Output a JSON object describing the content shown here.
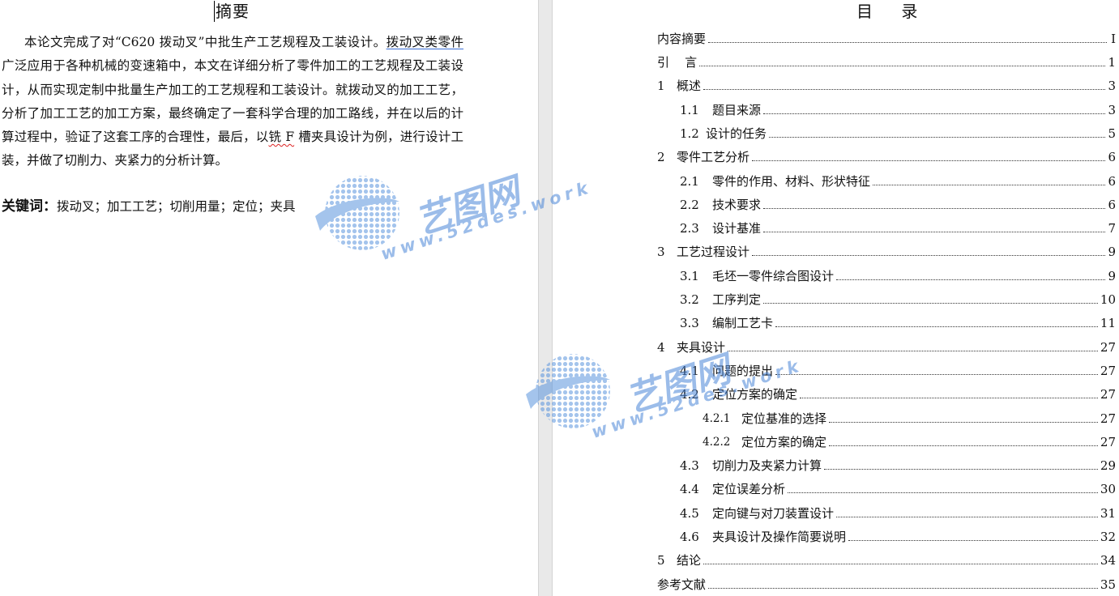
{
  "abstract": {
    "title": "摘要",
    "body_part1": "本论文完成了对“C620 拨动叉”中批生产工艺规程及工装设计。",
    "body_link": "拨动叉类零件",
    "body_part2": "广泛应用于各种机械的变速箱中，本文在详细分析了零件加工的工艺规程及工装设计，从而实现定制中批量生产加工的工艺规程和工装设计。就拨动叉的加工工艺，分析了加工工艺的加工方案，最终确定了一套科学合理的加工路线，并在以后的计算过程中，验证了这套工序的合理性，最后，以",
    "body_squig": "铣 F",
    "body_part3": " 槽夹具设计为例，进行设计工装，并做了切削力、夹紧力的分析计算。",
    "keywords_label": "关键词：",
    "keywords_value": "拨动叉；加工工艺；切削用量；定位；夹具"
  },
  "toc": {
    "title": "目    录",
    "entries": [
      {
        "num": "",
        "label": "内容摘要",
        "page": "I"
      },
      {
        "num": "",
        "label": "引    言",
        "page": "1"
      },
      {
        "num": "1",
        "label": "概述",
        "page": "3"
      },
      {
        "num": "1.1",
        "label": "题目来源",
        "page": "3"
      },
      {
        "num": "1.2",
        "label": "设计的任务",
        "page": "5"
      },
      {
        "num": "2",
        "label": "零件工艺分析",
        "page": "6"
      },
      {
        "num": "2.1",
        "label": "零件的作用、材料、形状特征",
        "page": "6"
      },
      {
        "num": "2.2",
        "label": "技术要求",
        "page": "6"
      },
      {
        "num": "2.3",
        "label": "设计基准",
        "page": "7"
      },
      {
        "num": "3",
        "label": "工艺过程设计",
        "page": "9"
      },
      {
        "num": "3.1",
        "label": "毛坯一零件综合图设计",
        "page": "9"
      },
      {
        "num": "3.2",
        "label": "工序判定",
        "page": "10"
      },
      {
        "num": "3.3",
        "label": "编制工艺卡",
        "page": "11"
      },
      {
        "num": "4",
        "label": "夹具设计",
        "page": "27"
      },
      {
        "num": "4.1",
        "label": "问题的提出",
        "page": "27"
      },
      {
        "num": "4.2",
        "label": "定位方案的确定",
        "page": "27"
      },
      {
        "num": "4.2.1",
        "label": "定位基准的选择",
        "page": "27"
      },
      {
        "num": "4.2.2",
        "label": "定位方案的确定",
        "page": "27"
      },
      {
        "num": "4.3",
        "label": "切削力及夹紧力计算",
        "page": "29"
      },
      {
        "num": "4.4",
        "label": "定位误差分析",
        "page": "30"
      },
      {
        "num": "4.5",
        "label": "定向键与对刀装置设计",
        "page": "31"
      },
      {
        "num": "4.6",
        "label": "夹具设计及操作简要说明",
        "page": "32"
      },
      {
        "num": "5",
        "label": "结论",
        "page": "34"
      },
      {
        "num": "",
        "label": "参考文献",
        "page": "35"
      }
    ]
  },
  "watermark": {
    "brand": "艺图网",
    "url": "www.52des.work",
    "color": "#4a86d8",
    "icon": "globe-icon"
  }
}
